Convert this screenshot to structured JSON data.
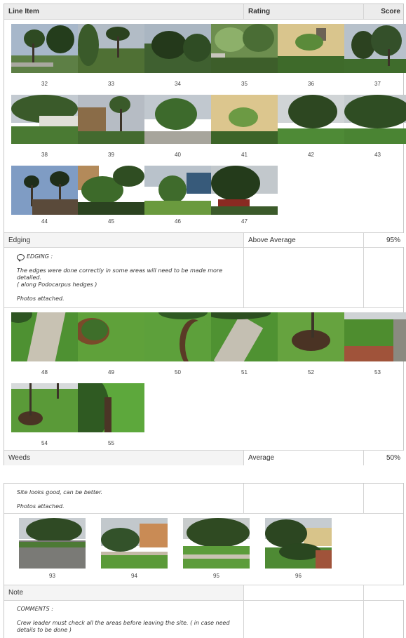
{
  "table": {
    "headers": {
      "item": "Line Item",
      "rating": "Rating",
      "score": "Score"
    }
  },
  "groups": {
    "first": {
      "labels": [
        "32",
        "33",
        "34",
        "35",
        "36",
        "37",
        "38",
        "39",
        "40",
        "41",
        "42",
        "43",
        "44",
        "45",
        "46",
        "47"
      ]
    },
    "edging": {
      "category": "Edging",
      "rating": "Above Average",
      "score": "95%",
      "comment_title": "EDGING :",
      "comment_body": "The edges were done correctly in some areas will need to be made more detailed.",
      "comment_note": "( along Podocarpus hedges )",
      "photos_text": "Photos attached.",
      "labels": [
        "48",
        "49",
        "50",
        "51",
        "52",
        "53",
        "54",
        "55"
      ]
    },
    "weeds": {
      "category": "Weeds",
      "rating": "Average",
      "score": "50%"
    },
    "site": {
      "comment_body": "Site looks good, can be better.",
      "photos_text": "Photos attached.",
      "labels": [
        "93",
        "94",
        "95",
        "96"
      ]
    },
    "note": {
      "category": "Note",
      "comment_title": "COMMENTS :",
      "comment_body": "Crew leader must check all the areas before leaving the site. ( in case need details to be done )"
    }
  },
  "colors": {
    "sky": "#9fb0c4",
    "foliage_dark": "#2f4a26",
    "foliage": "#4a6d35",
    "grass": "#5c9a3a",
    "wall": "#d8c48a",
    "path": "#b9b3a6"
  }
}
